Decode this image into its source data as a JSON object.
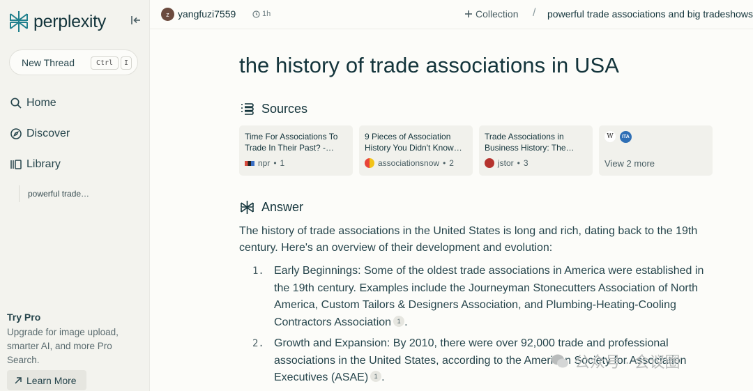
{
  "app": {
    "name": "perplexity"
  },
  "sidebar": {
    "new_thread": "New Thread",
    "kbd_ctrl": "Ctrl",
    "kbd_i": "I",
    "nav": [
      {
        "label": "Home",
        "icon": "search-icon"
      },
      {
        "label": "Discover",
        "icon": "compass-icon"
      },
      {
        "label": "Library",
        "icon": "library-icon"
      }
    ],
    "library_thread": "powerful trade…",
    "try_pro": "Try Pro",
    "try_pro_desc": "Upgrade for image upload, smarter AI, and more Pro Search.",
    "learn_more": "Learn More"
  },
  "topbar": {
    "avatar_initial": "z",
    "username": "yangfuzi7559",
    "time": "1h",
    "collection": "Collection",
    "breadcrumb_sep": "/",
    "thread_title": "powerful trade associations and big tradeshows"
  },
  "main": {
    "title": "the history of trade associations in USA",
    "sources_heading": "Sources",
    "sources": [
      {
        "title": "Time For Associations To Trade In Their Past? -…",
        "site": "npr",
        "index": "1",
        "favicon_color": "#d94b3d"
      },
      {
        "title": "9 Pieces of Association History You Didn't Know…",
        "site": "associationsnow",
        "index": "2",
        "favicon_color": "#f2c318"
      },
      {
        "title": "Trade Associations in Business History: The…",
        "site": "jstor",
        "index": "3",
        "favicon_color": "#b5332e"
      }
    ],
    "view_more": "View 2 more",
    "more_favicons": [
      "W",
      "ITA"
    ],
    "answer_heading": "Answer",
    "answer_intro": "The history of trade associations in the United States is long and rich, dating back to the 19th century. Here's an overview of their development and evolution:",
    "list": [
      {
        "num": "1.",
        "text": "Early Beginnings: Some of the oldest trade associations in America were established in the 19th century. Examples include the Journeyman Stonecutters Association of North America, Custom Tailors & Designers Association, and Plumbing-Heating-Cooling Contractors Association",
        "cite": "1",
        "tail": "."
      },
      {
        "num": "2.",
        "text": "Growth and Expansion: By 2010, there were over 92,000 trade and professional associations in the United States, according to the American Society for Association Executives (ASAE)",
        "cite": "1",
        "tail": "."
      }
    ]
  },
  "watermark": "公众号 · 会议圈",
  "colors": {
    "accent": "#20808d",
    "text": "#13343b",
    "sidebar_bg": "#f3f3ee",
    "page_bg": "#fcfcf9"
  }
}
